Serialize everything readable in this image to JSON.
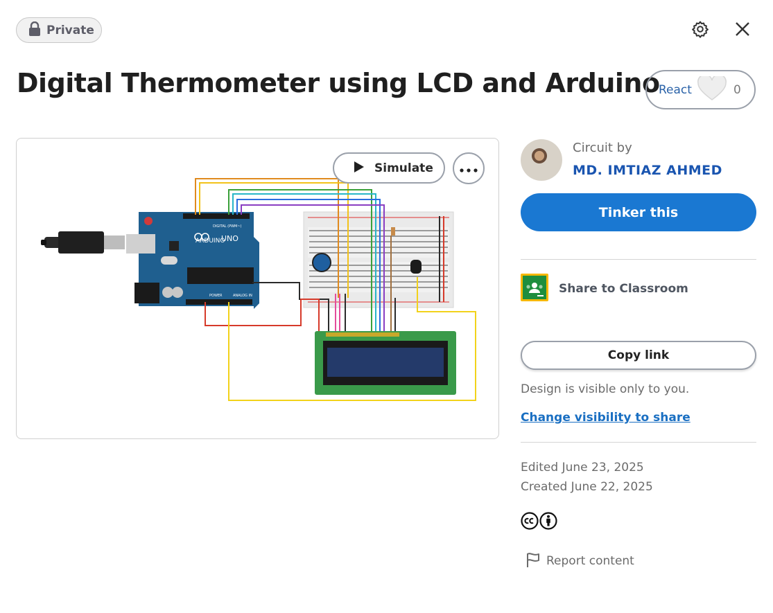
{
  "header": {
    "privacy_label": "Private",
    "settings_icon": "gear-icon",
    "close_icon": "close-icon"
  },
  "design": {
    "title": "Digital Thermometer using LCD and Arduino",
    "react_label": "React",
    "react_count": "0",
    "simulate_label": "Simulate",
    "board_labels": {
      "uno": "UNO",
      "arduino": "ARDUINO",
      "digital": "DIGITAL (PWM~)",
      "power": "POWER",
      "analog": "ANALOG IN"
    }
  },
  "sidebar": {
    "circuit_by": "Circuit by",
    "author": "MD. IMTIAZ AHMED",
    "tinker_label": "Tinker this",
    "share_label": "Share to Classroom",
    "copy_link_label": "Copy link",
    "visibility_note": "Design is visible only to you.",
    "change_visibility_label": "Change visibility to share",
    "edited": "Edited June 23, 2025",
    "created": "Created June 22, 2025",
    "report_label": "Report content"
  },
  "colors": {
    "accent": "#1a78d2",
    "author": "#1a55b0",
    "classroom_green": "#1e8e3e",
    "classroom_yellow": "#f5b800"
  }
}
